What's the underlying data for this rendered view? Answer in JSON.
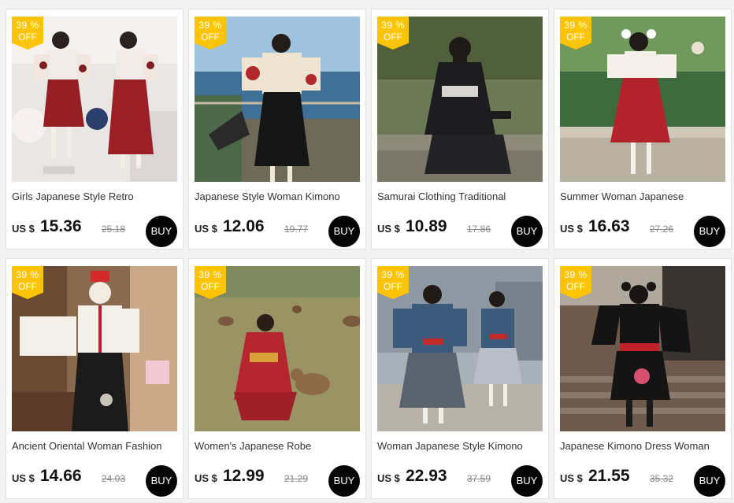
{
  "products": [
    {
      "badge_pct": "39 %",
      "badge_off": "OFF",
      "title": "Girls Japanese Style Retro",
      "currency": "US $",
      "price": "15.36",
      "old_price": "25.18",
      "buy_label": "BUY",
      "image": "two-girls-red-skirt"
    },
    {
      "badge_pct": "39 %",
      "badge_off": "OFF",
      "title": "Japanese Style Woman Kimono",
      "currency": "US $",
      "price": "12.06",
      "old_price": "19.77",
      "buy_label": "BUY",
      "image": "woman-by-sea"
    },
    {
      "badge_pct": "39 %",
      "badge_off": "OFF",
      "title": "Samurai Clothing Traditional",
      "currency": "US $",
      "price": "10.89",
      "old_price": "17.86",
      "buy_label": "BUY",
      "image": "woman-black-kimono"
    },
    {
      "badge_pct": "39 %",
      "badge_off": "OFF",
      "title": "Summer Woman Japanese",
      "currency": "US $",
      "price": "16.63",
      "old_price": "27.26",
      "buy_label": "BUY",
      "image": "girl-red-skirt-garden"
    },
    {
      "badge_pct": "39 %",
      "badge_off": "OFF",
      "title": "Ancient Oriental Woman Fashion",
      "currency": "US $",
      "price": "14.66",
      "old_price": "24.03",
      "buy_label": "BUY",
      "image": "girl-white-robe-mask"
    },
    {
      "badge_pct": "39 %",
      "badge_off": "OFF",
      "title": "Women's Japanese Robe",
      "currency": "US $",
      "price": "12.99",
      "old_price": "21.29",
      "buy_label": "BUY",
      "image": "woman-with-deer"
    },
    {
      "badge_pct": "39 %",
      "badge_off": "OFF",
      "title": "Woman Japanese Style Kimono",
      "currency": "US $",
      "price": "22.93",
      "old_price": "37.59",
      "buy_label": "BUY",
      "image": "two-girls-denim"
    },
    {
      "badge_pct": "39 %",
      "badge_off": "OFF",
      "title": "Japanese Kimono Dress Woman",
      "currency": "US $",
      "price": "21.55",
      "old_price": "35.32",
      "buy_label": "BUY",
      "image": "woman-black-dress-stairs"
    }
  ],
  "colors": {
    "badge": "#ffc400",
    "buy": "#050505",
    "background": "#f3f3f3"
  }
}
